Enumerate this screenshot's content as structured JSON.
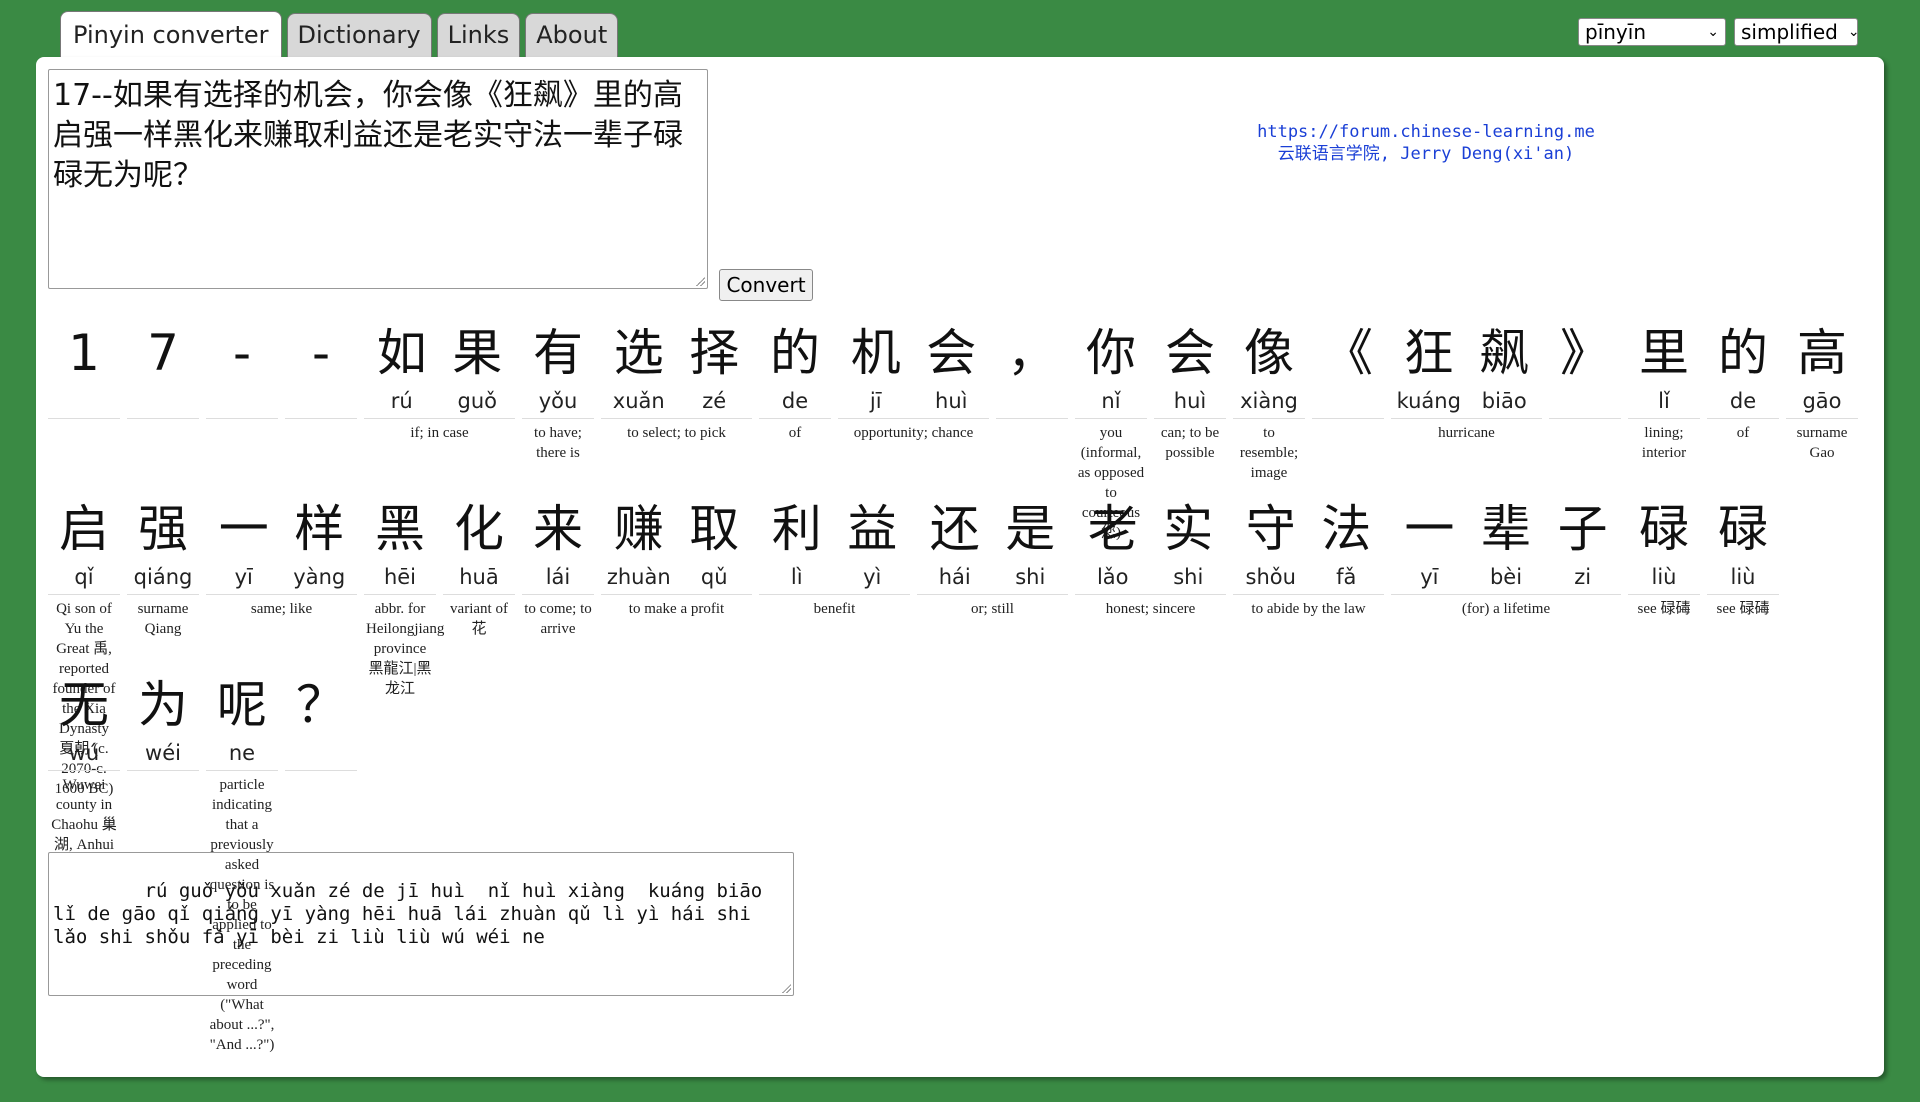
{
  "tabs": [
    "Pinyin converter",
    "Dictionary",
    "Links",
    "About"
  ],
  "selects": {
    "mode": "pīnyīn",
    "script": "simplified"
  },
  "input_text": "17--如果有选择的机会，你会像《狂飙》里的高启强一样黑化来赚取利益还是老实守法一辈子碌碌无为呢？",
  "convert_label": "Convert",
  "credit": {
    "line1": "https://forum.chinese-learning.me",
    "line2": "云联语言学院, Jerry Deng(xi'an)"
  },
  "rows": [
    [
      {
        "chars": [
          "1"
        ],
        "pinyin": [
          ""
        ],
        "en": ""
      },
      {
        "chars": [
          "7"
        ],
        "pinyin": [
          ""
        ],
        "en": ""
      },
      {
        "chars": [
          "-"
        ],
        "pinyin": [
          ""
        ],
        "en": ""
      },
      {
        "chars": [
          "-"
        ],
        "pinyin": [
          ""
        ],
        "en": ""
      },
      {
        "chars": [
          "如",
          "果"
        ],
        "pinyin": [
          "rú",
          "guǒ"
        ],
        "en": "if; in case"
      },
      {
        "chars": [
          "有"
        ],
        "pinyin": [
          "yǒu"
        ],
        "en": "to have; there is"
      },
      {
        "chars": [
          "选",
          "择"
        ],
        "pinyin": [
          "xuǎn",
          "zé"
        ],
        "en": "to select; to pick"
      },
      {
        "chars": [
          "的"
        ],
        "pinyin": [
          "de"
        ],
        "en": "of"
      },
      {
        "chars": [
          "机",
          "会"
        ],
        "pinyin": [
          "jī",
          "huì"
        ],
        "en": "opportunity; chance"
      },
      {
        "chars": [
          "，"
        ],
        "pinyin": [
          ""
        ],
        "en": ""
      },
      {
        "chars": [
          "你"
        ],
        "pinyin": [
          "nǐ"
        ],
        "en": "you (informal, as opposed to courteous 您)"
      },
      {
        "chars": [
          "会"
        ],
        "pinyin": [
          "huì"
        ],
        "en": "can; to be possible"
      },
      {
        "chars": [
          "像"
        ],
        "pinyin": [
          "xiàng"
        ],
        "en": "to resemble; image"
      },
      {
        "chars": [
          "《"
        ],
        "pinyin": [
          ""
        ],
        "en": ""
      },
      {
        "chars": [
          "狂",
          "飙"
        ],
        "pinyin": [
          "kuáng",
          "biāo"
        ],
        "en": "hurricane"
      },
      {
        "chars": [
          "》"
        ],
        "pinyin": [
          ""
        ],
        "en": ""
      },
      {
        "chars": [
          "里"
        ],
        "pinyin": [
          "lǐ"
        ],
        "en": "lining; interior"
      },
      {
        "chars": [
          "的"
        ],
        "pinyin": [
          "de"
        ],
        "en": "of"
      },
      {
        "chars": [
          "高"
        ],
        "pinyin": [
          "gāo"
        ],
        "en": "surname Gao"
      }
    ],
    [
      {
        "chars": [
          "启"
        ],
        "pinyin": [
          "qǐ"
        ],
        "en": "Qi son of Yu the Great 禹, reported founder of the Xia Dynasty 夏朝 (c. 2070-c. 1600 BC)"
      },
      {
        "chars": [
          "强"
        ],
        "pinyin": [
          "qiáng"
        ],
        "en": "surname Qiang"
      },
      {
        "chars": [
          "一",
          "样"
        ],
        "pinyin": [
          "yī",
          "yàng"
        ],
        "en": "same; like"
      },
      {
        "chars": [
          "黑"
        ],
        "pinyin": [
          "hēi"
        ],
        "en": "abbr. for Heilongjiang province 黑龍江|黑龙江"
      },
      {
        "chars": [
          "化"
        ],
        "pinyin": [
          "huā"
        ],
        "en": "variant of 花"
      },
      {
        "chars": [
          "来"
        ],
        "pinyin": [
          "lái"
        ],
        "en": "to come; to arrive"
      },
      {
        "chars": [
          "赚",
          "取"
        ],
        "pinyin": [
          "zhuàn",
          "qǔ"
        ],
        "en": "to make a profit"
      },
      {
        "chars": [
          "利",
          "益"
        ],
        "pinyin": [
          "lì",
          "yì"
        ],
        "en": "benefit"
      },
      {
        "chars": [
          "还",
          "是"
        ],
        "pinyin": [
          "hái",
          "shi"
        ],
        "en": "or; still"
      },
      {
        "chars": [
          "老",
          "实"
        ],
        "pinyin": [
          "lǎo",
          "shi"
        ],
        "en": "honest; sincere"
      },
      {
        "chars": [
          "守",
          "法"
        ],
        "pinyin": [
          "shǒu",
          "fǎ"
        ],
        "en": "to abide by the law"
      },
      {
        "chars": [
          "一",
          "辈",
          "子"
        ],
        "pinyin": [
          "yī",
          "bèi",
          "zi"
        ],
        "en": "(for) a lifetime"
      },
      {
        "chars": [
          "碌"
        ],
        "pinyin": [
          "liù"
        ],
        "en": "see 碌碡"
      },
      {
        "chars": [
          "碌"
        ],
        "pinyin": [
          "liù"
        ],
        "en": "see 碌碡"
      }
    ],
    [
      {
        "chars": [
          "无"
        ],
        "pinyin": [
          "wú"
        ],
        "en": "Wuwei county in Chaohu 巢湖, Anhui"
      },
      {
        "chars": [
          "为"
        ],
        "pinyin": [
          "wéi"
        ],
        "en": ""
      },
      {
        "chars": [
          "呢"
        ],
        "pinyin": [
          "ne"
        ],
        "en": "particle indicating that a previously asked question is to be applied to the preceding word (\"What about ...?\", \"And ...?\")"
      },
      {
        "chars": [
          "？"
        ],
        "pinyin": [
          ""
        ],
        "en": ""
      }
    ]
  ],
  "pinyin_output": "    rú guǒ yǒu xuǎn zé de jī huì  nǐ huì xiàng  kuáng biāo\nlǐ de gāo qǐ qiáng yī yàng hēi huā lái zhuàn qǔ lì yì hái shi\nlǎo shi shǒu fǎ yī bèi zi liù liù wú wéi ne"
}
